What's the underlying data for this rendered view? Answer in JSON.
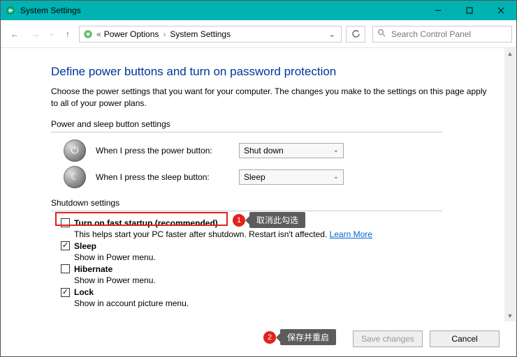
{
  "window": {
    "title": "System Settings"
  },
  "nav": {
    "crumb1": "Power Options",
    "crumb2": "System Settings",
    "search_placeholder": "Search Control Panel"
  },
  "page": {
    "heading": "Define power buttons and turn on password protection",
    "description": "Choose the power settings that you want for your computer. The changes you make to the settings on this page apply to all of your power plans."
  },
  "power_sleep": {
    "section_title": "Power and sleep button settings",
    "power_label": "When I press the power button:",
    "power_value": "Shut down",
    "sleep_label": "When I press the sleep button:",
    "sleep_value": "Sleep"
  },
  "shutdown": {
    "section_title": "Shutdown settings",
    "fast_startup": {
      "label": "Turn on fast startup (recommended)",
      "sub": "This helps start your PC faster after shutdown. Restart isn't affected. ",
      "link": "Learn More"
    },
    "sleep": {
      "label": "Sleep",
      "sub": "Show in Power menu."
    },
    "hibernate": {
      "label": "Hibernate",
      "sub": "Show in Power menu."
    },
    "lock": {
      "label": "Lock",
      "sub": "Show in account picture menu."
    }
  },
  "annotations": {
    "a1_num": "1",
    "a1_text": "取消此勾选",
    "a2_num": "2",
    "a2_text": "保存并重启"
  },
  "footer": {
    "save": "Save changes",
    "cancel": "Cancel"
  }
}
